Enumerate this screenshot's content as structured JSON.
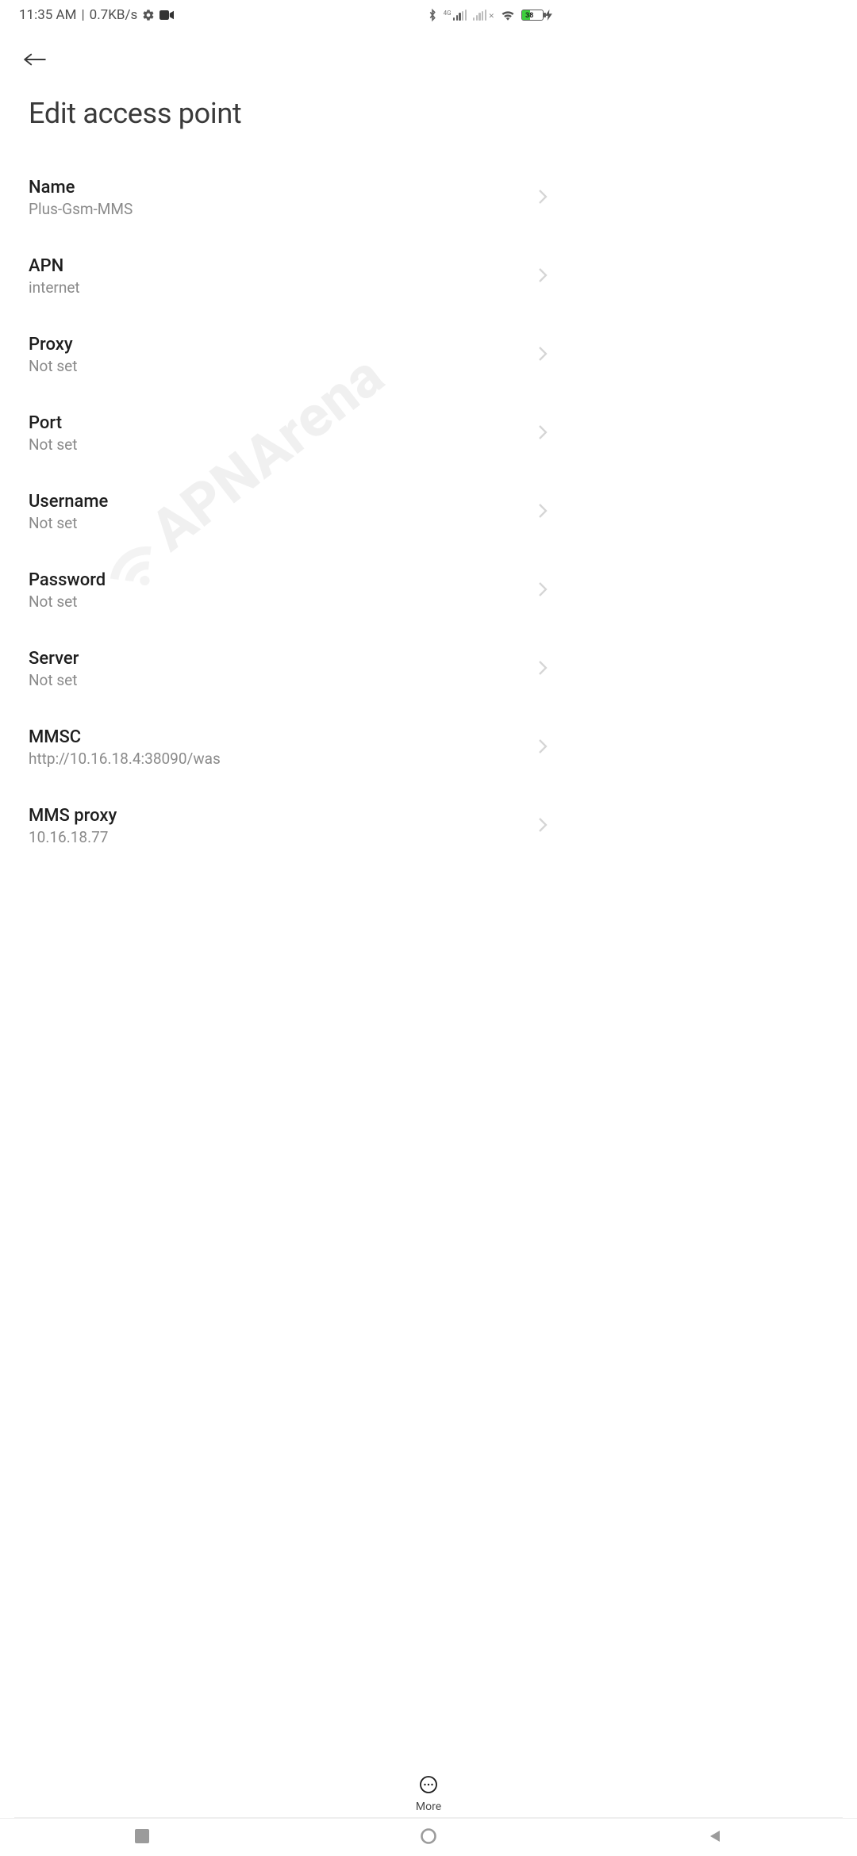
{
  "status": {
    "time": "11:35 AM",
    "sep": " | ",
    "net_speed": "0.7KB/s",
    "sig1_label": "4G",
    "battery_pct": "38",
    "battery_fill_pct": 38,
    "battery_color": "#3ecf3e"
  },
  "page": {
    "title": "Edit access point"
  },
  "items": [
    {
      "label": "Name",
      "value": "Plus-Gsm-MMS"
    },
    {
      "label": "APN",
      "value": "internet"
    },
    {
      "label": "Proxy",
      "value": "Not set"
    },
    {
      "label": "Port",
      "value": "Not set"
    },
    {
      "label": "Username",
      "value": "Not set"
    },
    {
      "label": "Password",
      "value": "Not set"
    },
    {
      "label": "Server",
      "value": "Not set"
    },
    {
      "label": "MMSC",
      "value": "http://10.16.18.4:38090/was"
    },
    {
      "label": "MMS proxy",
      "value": "10.16.18.77"
    }
  ],
  "footer": {
    "more_label": "More"
  },
  "watermark": "APNArena"
}
